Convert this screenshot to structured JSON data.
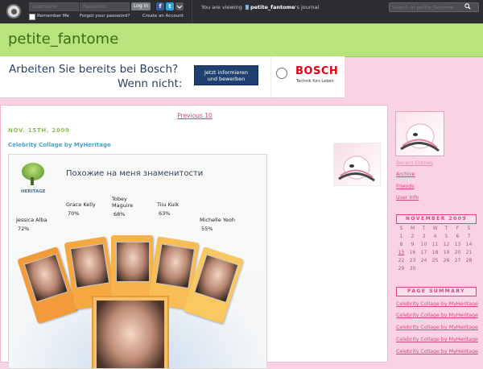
{
  "topbar": {
    "username_placeholder": "Username",
    "password_placeholder": "Password",
    "login_label": "Log in",
    "remember_label": "Remember Me",
    "forgot_label": "Forgot your password?",
    "create_label": "Create an Account",
    "viewing_prefix": "You are viewing",
    "viewing_user": "petite_fantome",
    "viewing_suffix": "'s journal",
    "search_placeholder": "Search at petite_fantome",
    "facebook_glyph": "f",
    "twitter_glyph": "t"
  },
  "header": {
    "title": "petite_fantome"
  },
  "ad": {
    "line1": "Arbeiten Sie bereits bei Bosch?",
    "line2": "Wenn nicht:",
    "cta_line1": "Jetzt informieren",
    "cta_line2": "und bewerben",
    "brand": "BOSCH",
    "tagline": "Technik fürs Leben"
  },
  "main": {
    "previous": "Previous 10",
    "date": "NOV. 15TH, 2009",
    "entry_title": "Celebrity Collage by MyHeritage"
  },
  "collage": {
    "heritage_label": "HERITAGE",
    "headline": "Похожие на меня знаменитости",
    "celebs": [
      {
        "name": "Jessica Alba",
        "pct": "72%"
      },
      {
        "name": "Grace Kelly",
        "pct": "70%"
      },
      {
        "name": "Tobey\nMaguire",
        "pct": "68%"
      },
      {
        "name": "Tiiu Kuik",
        "pct": "63%"
      },
      {
        "name": "Michelle Yeoh",
        "pct": "55%"
      }
    ]
  },
  "sidebar": {
    "links": [
      "Recent Entries",
      "Archive",
      "Friends",
      "User Info"
    ],
    "calendar_title": "NOVEMBER 2009",
    "weekdays": [
      "S",
      "M",
      "T",
      "W",
      "T",
      "F",
      "S"
    ],
    "weeks": [
      [
        "1",
        "2",
        "3",
        "4",
        "5",
        "6",
        "7"
      ],
      [
        "8",
        "9",
        "10",
        "11",
        "12",
        "13",
        "14"
      ],
      [
        "15",
        "16",
        "17",
        "18",
        "19",
        "20",
        "21"
      ],
      [
        "22",
        "23",
        "24",
        "25",
        "26",
        "27",
        "28"
      ],
      [
        "29",
        "30",
        "",
        "",
        "",
        "",
        ""
      ]
    ],
    "summary_title": "PAGE SUMMARY",
    "summary_items": [
      "Celebrity Collage by MyHeritage",
      "Celebrity Collage by MyHeritage",
      "Celebrity Collage by MyHeritage",
      "Celebrity Collage by MyHeritage",
      "Celebrity Collage by MyHeritage"
    ]
  },
  "colors": {
    "accent": "#d44583",
    "header_green": "#b9e47d",
    "title_green": "#3a6d16",
    "page_pink": "#f9d3e3"
  }
}
